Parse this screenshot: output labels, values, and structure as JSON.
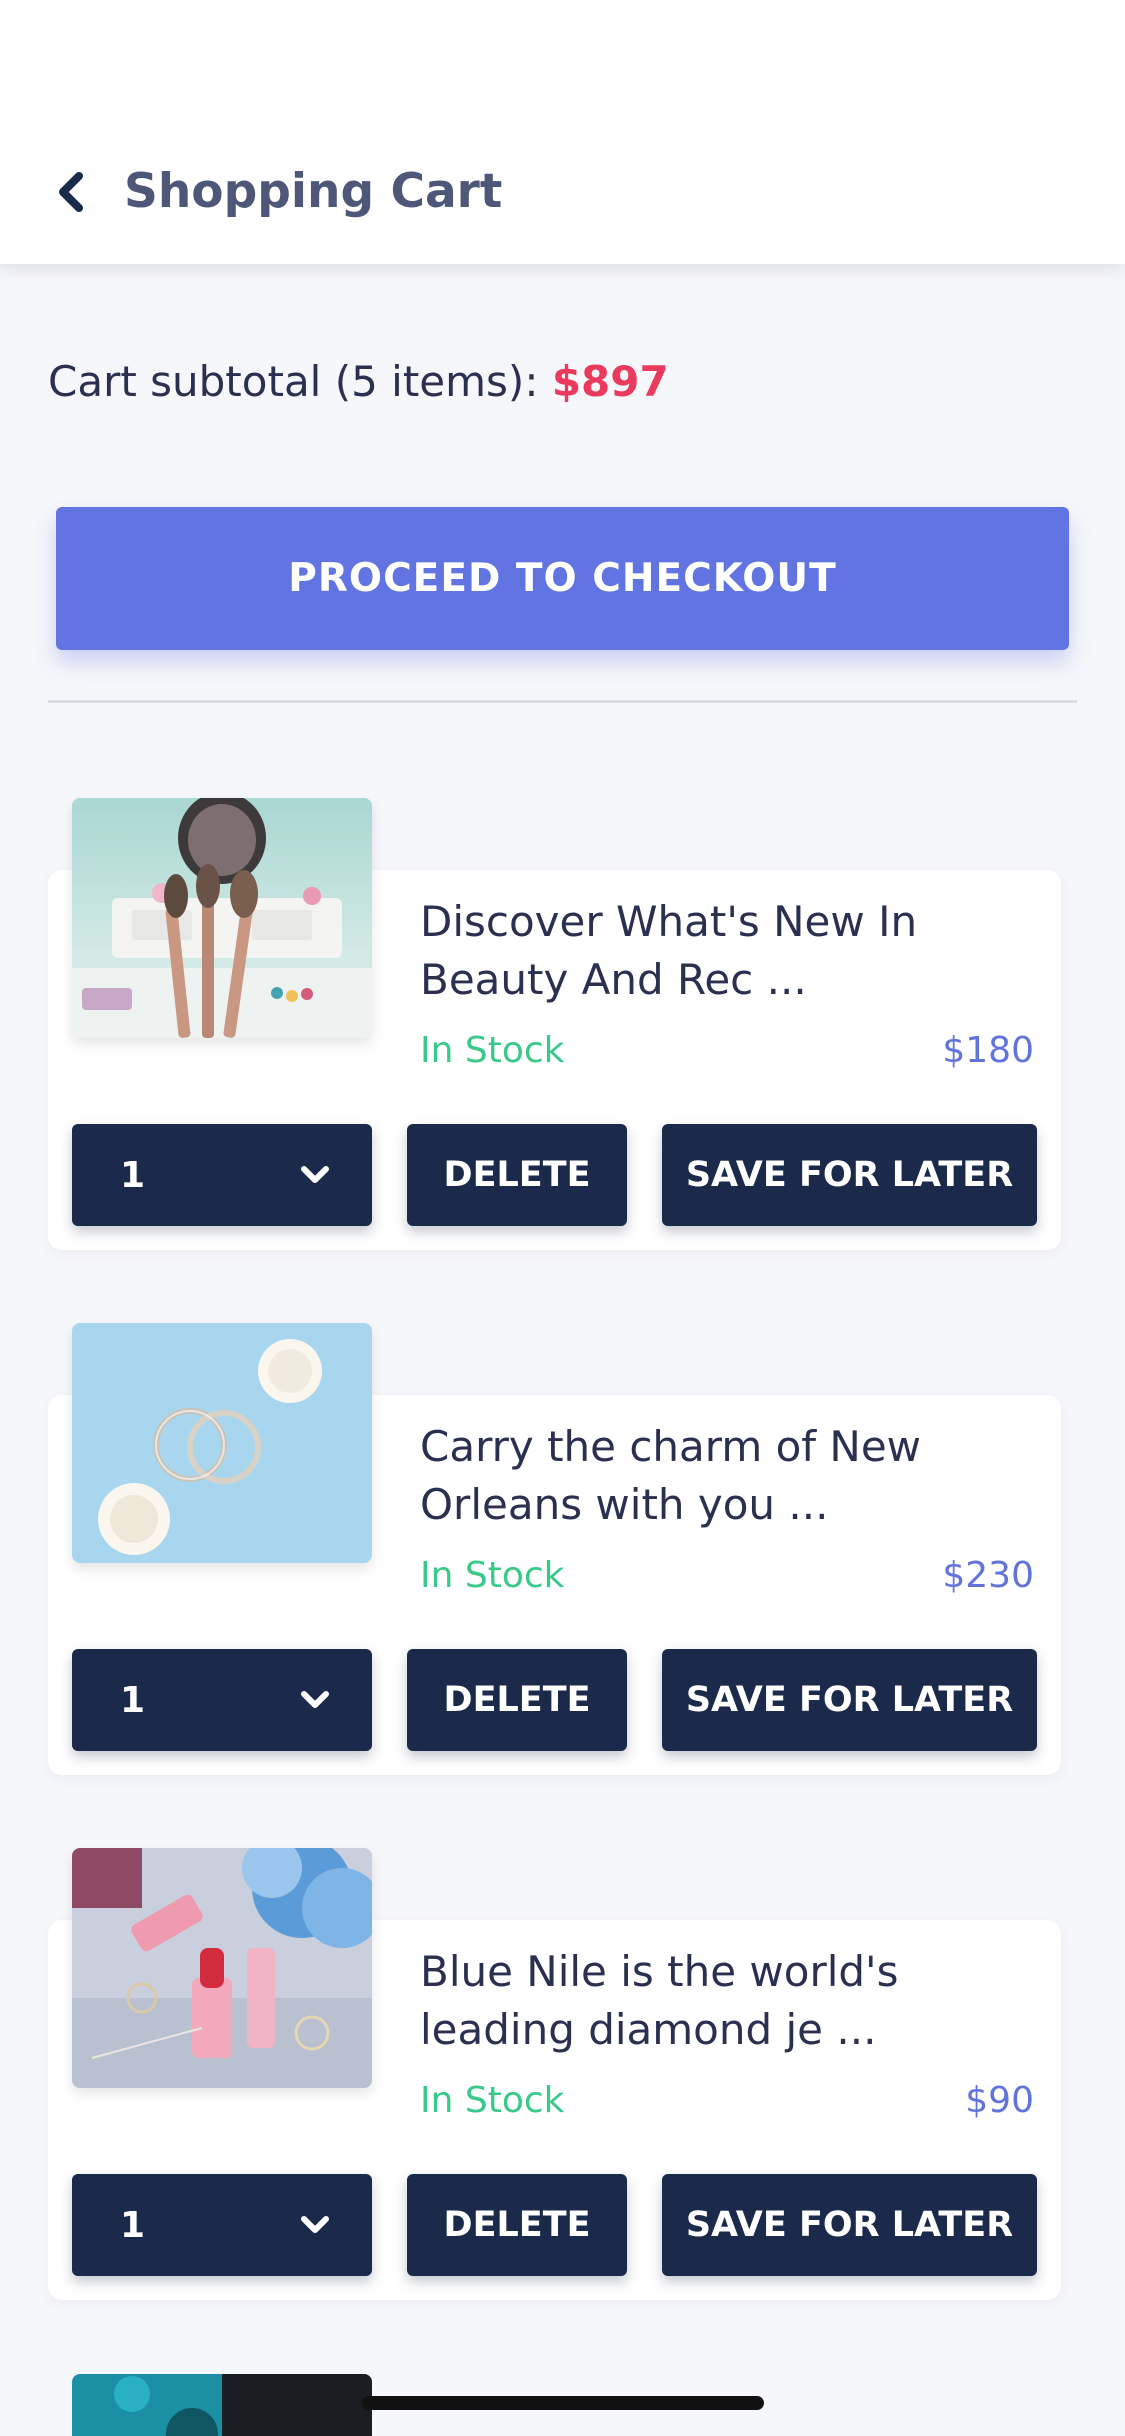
{
  "header": {
    "back_icon": "chevron-left-icon",
    "title": "Shopping Cart"
  },
  "cart": {
    "subtotal_label": "Cart subtotal (5 items): ",
    "subtotal_amount": "$897",
    "checkout_label": "PROCEED TO CHECKOUT"
  },
  "items": [
    {
      "title": "Discover What's New In Beauty And Rec ...",
      "stock": "In Stock",
      "price": "$180",
      "quantity": "1",
      "delete_label": "DELETE",
      "save_label": "SAVE FOR LATER"
    },
    {
      "title": "Carry the charm of New Orleans with you ...",
      "stock": "In Stock",
      "price": "$230",
      "quantity": "1",
      "delete_label": "DELETE",
      "save_label": "SAVE FOR LATER"
    },
    {
      "title": "Blue Nile is the world's leading diamond je ...",
      "stock": "In Stock",
      "price": "$90",
      "quantity": "1",
      "delete_label": "DELETE",
      "save_label": "SAVE FOR LATER"
    }
  ],
  "colors": {
    "accent": "#6274e2",
    "dark_button": "#1b2a4b",
    "subtotal_amount": "#ea3a5d",
    "in_stock": "#3bc98a",
    "price": "#6273dc"
  }
}
